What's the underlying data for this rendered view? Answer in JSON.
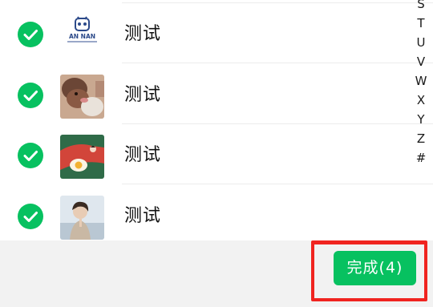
{
  "contacts": [
    {
      "name": "测试",
      "avatar_icon": "an-nan-logo-avatar",
      "avatar_text": "AN NAN",
      "checked": true
    },
    {
      "name": "测试",
      "avatar_icon": "dog-photo-avatar",
      "checked": true
    },
    {
      "name": "测试",
      "avatar_icon": "fried-egg-illustration-avatar",
      "checked": true
    },
    {
      "name": "测试",
      "avatar_icon": "person-seaside-photo-avatar",
      "checked": true
    }
  ],
  "index_bar": {
    "letters": [
      "S",
      "T",
      "U",
      "V",
      "W",
      "X",
      "Y",
      "Z",
      "#"
    ]
  },
  "footer": {
    "done_label": "完成(4)"
  },
  "colors": {
    "accent": "#07c160",
    "highlight_border": "#f02420",
    "footer_bg": "#f2f2f2"
  }
}
